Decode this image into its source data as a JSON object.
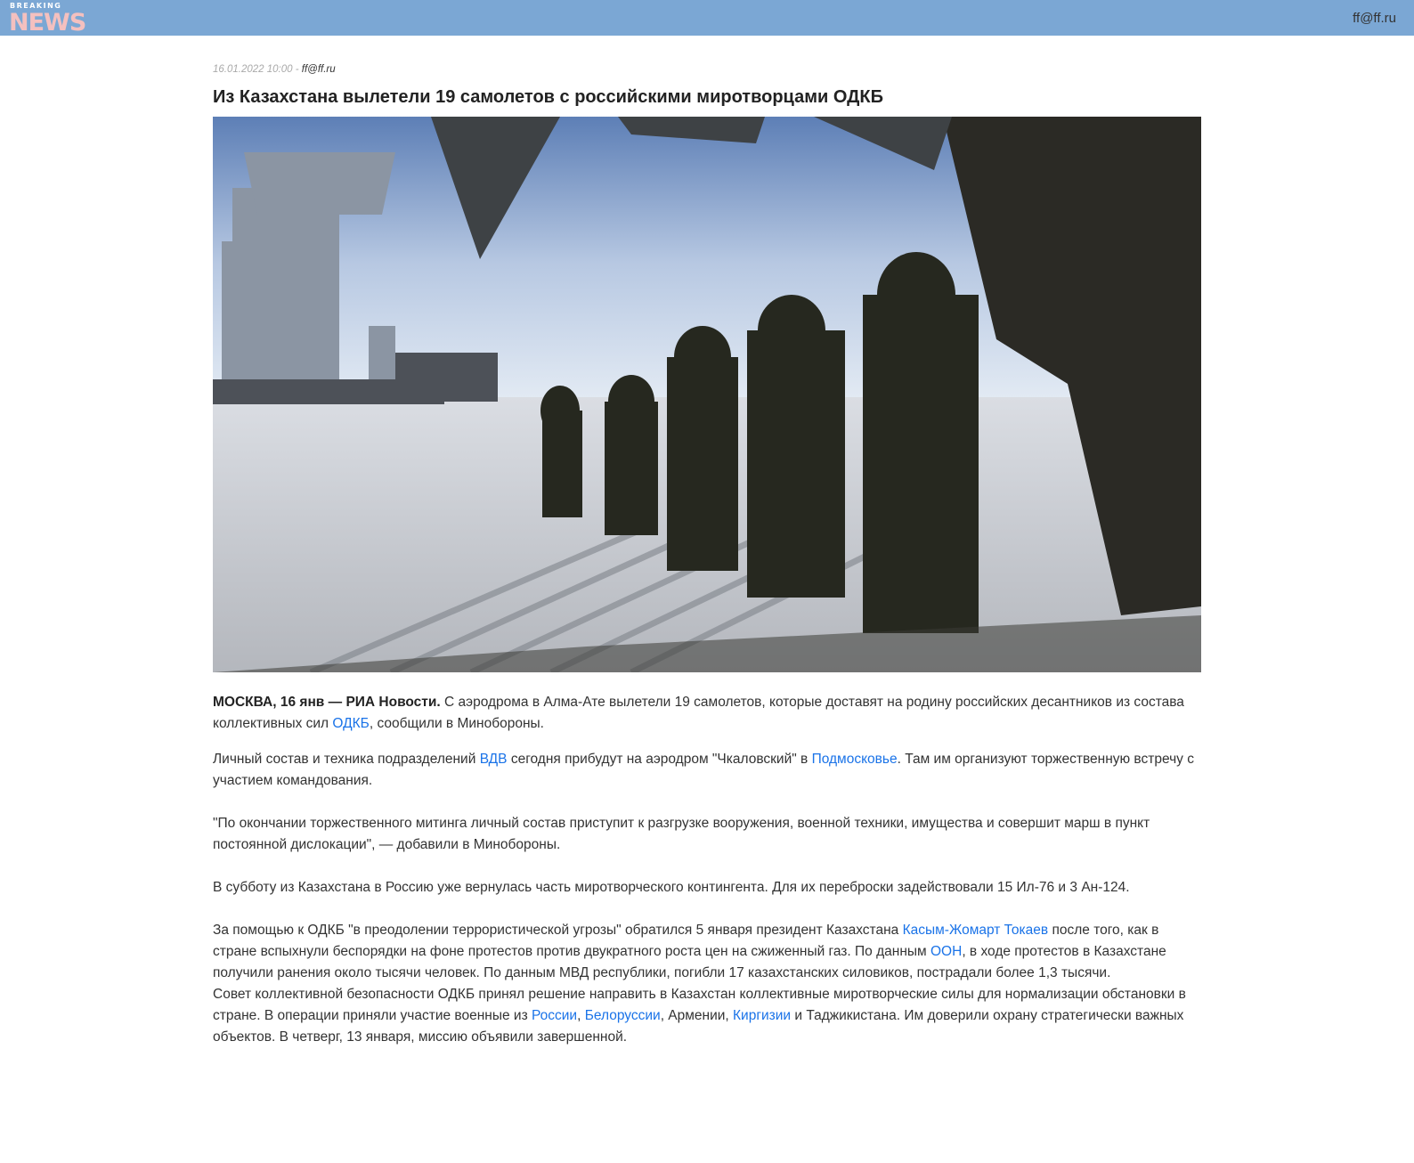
{
  "header": {
    "logo_top": "BREAKING",
    "logo_bottom": "NEWS",
    "user_email": "ff@ff.ru"
  },
  "article": {
    "date": "16.01.2022 10:00",
    "separator": " - ",
    "author": "ff@ff.ru",
    "title": "Из Казахстана вылетели 19 самолетов с российскими миротворцами ОДКБ",
    "p1": {
      "lead": "МОСКВА, 16 янв — РИА Новости.",
      "t1": " С аэродрома в Алма-Ате вылетели 19 самолетов, которые доставят на родину российских десантников из состава коллективных сил ",
      "link_odkb": "ОДКБ",
      "t2": ", сообщили в Минобороны."
    },
    "p2": {
      "t1": "Личный состав и техника подразделений ",
      "link_vdv": "ВДВ",
      "t2": " сегодня прибудут на аэродром \"Чкаловский\" в ",
      "link_podmoskovye": "Подмосковье",
      "t3": ". Там им организуют торжественную встречу с участием командования."
    },
    "p3": "\"По окончании торжественного митинга личный состав приступит к разгрузке вооружения, военной техники, имущества и совершит марш в пункт постоянной дислокации\", — добавили в Минобороны.",
    "p4": "В субботу из Казахстана в Россию уже вернулась часть миротворческого контингента. Для их переброски задействовали 15 Ил-76 и 3 Ан-124.",
    "p5": {
      "t1": "За помощью к ОДКБ \"в преодолении террористической угрозы\" обратился 5 января президент Казахстана ",
      "link_tokayev": "Касым-Жомарт Токаев",
      "t2": " после того, как в стране вспыхнули беспорядки на фоне протестов против двукратного роста цен на сжиженный газ. По данным ",
      "link_oon": "ООН",
      "t3": ", в ходе протестов в Казахстане получили ранения около тысячи человек. По данным МВД республики, погибли 17 казахстанских силовиков, пострадали более 1,3 тысячи."
    },
    "p6": {
      "t1": "Совет коллективной безопасности ОДКБ принял решение направить в Казахстан коллективные миротворческие силы для нормализации обстановки в стране. В операции приняли участие военные из ",
      "link_russia": "России",
      "sep1": ", ",
      "link_belarus": "Белоруссии",
      "t2": ", Армении, ",
      "link_kyrgyzstan": "Киргизии",
      "t3": " и Таджикистана. Им доверили охрану стратегически важных объектов. В четверг, 13 января, миссию объявили завершенной."
    }
  },
  "colors": {
    "topbar": "#7ba7d4",
    "link": "#1a73e8",
    "logo_news": "#f4c0bf"
  }
}
